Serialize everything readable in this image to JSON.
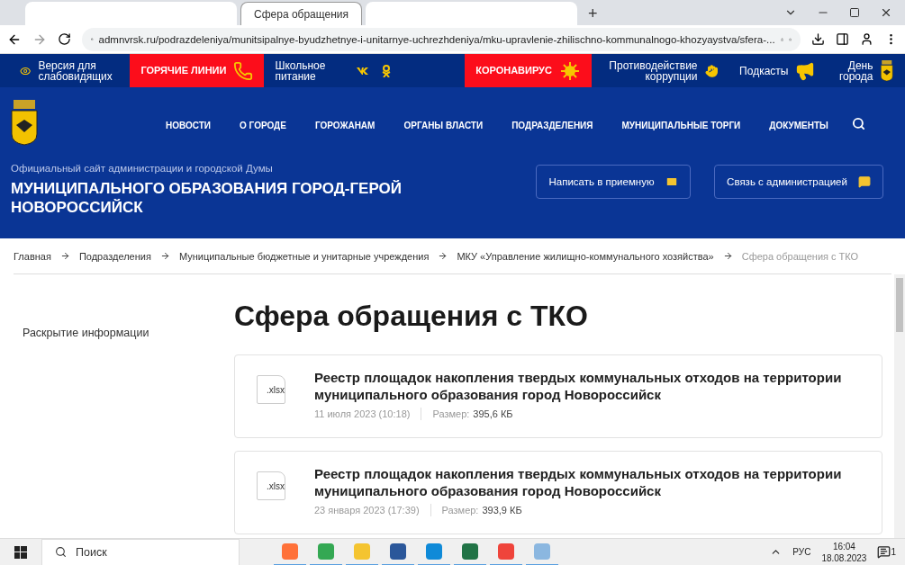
{
  "browser": {
    "tabs": [
      {
        "selected": false
      },
      {
        "title": "Сфера обращения",
        "selected": true
      },
      {
        "selected": false
      }
    ],
    "new_tab": "+",
    "url": "admnvrsk.ru/podrazdeleniya/munitsipalnye-byudzhetnye-i-unitarnye-uchrezhdeniya/mku-upravlenie-zhilischno-kommunalnogo-khozyaystva/sfera-..."
  },
  "top_strip": [
    {
      "kind": "plain",
      "label": "Версия для слабовидящих"
    },
    {
      "kind": "red",
      "label": "ГОРЯЧИЕ ЛИНИИ"
    },
    {
      "kind": "plain",
      "label": "Школьное питание"
    },
    {
      "kind": "social"
    },
    {
      "kind": "red",
      "label": "КОРОНАВИРУС"
    },
    {
      "kind": "plain",
      "label": "Противодействие коррупции"
    },
    {
      "kind": "plain",
      "label": "Подкасты"
    },
    {
      "kind": "plain",
      "label": "День города"
    }
  ],
  "nav": [
    "НОВОСТИ",
    "О ГОРОДЕ",
    "ГОРОЖАНАМ",
    "ОРГАНЫ ВЛАСТИ",
    "ПОДРАЗДЕЛЕНИЯ",
    "МУНИЦИПАЛЬНЫЕ ТОРГИ",
    "ДОКУМЕНТЫ"
  ],
  "site": {
    "subtitle": "Официальный сайт администрации и городской Думы",
    "title": "МУНИЦИПАЛЬНОГО ОБРАЗОВАНИЯ ГОРОД-ГЕРОЙ НОВОРОССИЙСК"
  },
  "header_buttons": [
    "Написать в приемную",
    "Связь с администрацией"
  ],
  "breadcrumbs": [
    {
      "label": "Главная",
      "current": false
    },
    {
      "label": "Подразделения",
      "current": false
    },
    {
      "label": "Муниципальные бюджетные и унитарные учреждения",
      "current": false
    },
    {
      "label": "МКУ «Управление жилищно-коммунального хозяйства»",
      "current": false
    },
    {
      "label": "Сфера обращения с ТКО",
      "current": true
    }
  ],
  "sidebar": {
    "items": [
      "Раскрытие информации"
    ]
  },
  "page_title": "Сфера обращения с ТКО",
  "documents": [
    {
      "ext": ".xlsx",
      "title": "Реестр площадок накопления твердых коммунальных отходов на территории муниципального образования город Новороссийск",
      "date": "11 июля 2023 (10:18)",
      "size_label": "Размер:",
      "size": "395,6 КБ"
    },
    {
      "ext": ".xlsx",
      "title": "Реестр площадок накопления твердых коммунальных отходов на территории муниципального образования город Новороссийск",
      "date": "23 января 2023 (17:39)",
      "size_label": "Размер:",
      "size": "393,9 КБ"
    }
  ],
  "taskbar": {
    "search": "Поиск",
    "language": "РУС",
    "time": "16:04",
    "date": "18.08.2023",
    "notifications": "1"
  }
}
